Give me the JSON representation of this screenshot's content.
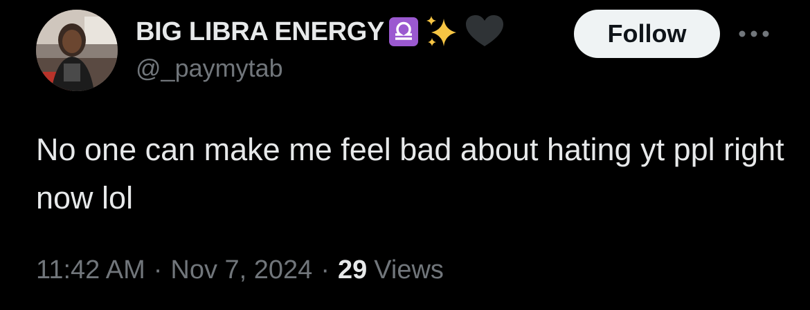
{
  "author": {
    "display_name": "BIG LIBRA ENERGY",
    "name_emojis": [
      "libra-sign-icon",
      "sparkles-icon",
      "black-heart-icon"
    ],
    "handle": "@_paymytab"
  },
  "actions": {
    "follow_label": "Follow",
    "more_icon": "more-dots-icon"
  },
  "tweet": {
    "text": "No one can make me feel bad about hating yt ppl right now lol",
    "time": "11:42 AM",
    "separator": "·",
    "date": "Nov 7, 2024",
    "views_count": "29",
    "views_label": "Views"
  },
  "colors": {
    "background": "#000000",
    "primary_text": "#e7e9ea",
    "secondary_text": "#71767b",
    "follow_button_bg": "#eff3f4",
    "libra_badge": "#9b59d0"
  }
}
